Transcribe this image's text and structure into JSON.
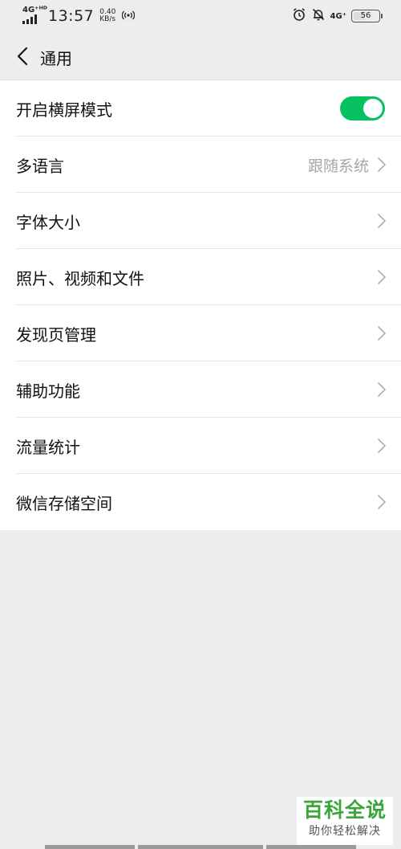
{
  "status_bar": {
    "network": "4G⁺ᴴᴰ",
    "time": "13:57",
    "speed_value": "0.40",
    "speed_unit": "KB/s",
    "network_right": "4G⁺",
    "battery": "56"
  },
  "nav": {
    "title": "通用"
  },
  "settings": {
    "landscape": {
      "label": "开启横屏模式",
      "enabled": true
    },
    "language": {
      "label": "多语言",
      "value": "跟随系统"
    },
    "font_size": {
      "label": "字体大小"
    },
    "media": {
      "label": "照片、视频和文件"
    },
    "discover": {
      "label": "发现页管理"
    },
    "accessibility": {
      "label": "辅助功能"
    },
    "data_usage": {
      "label": "流量统计"
    },
    "storage": {
      "label": "微信存储空间"
    }
  },
  "watermark": {
    "title": "百科全说",
    "subtitle": "助你轻松解决"
  },
  "colors": {
    "accent_green": "#07c160",
    "background": "#ededed",
    "secondary_text": "#a6a6a6"
  }
}
